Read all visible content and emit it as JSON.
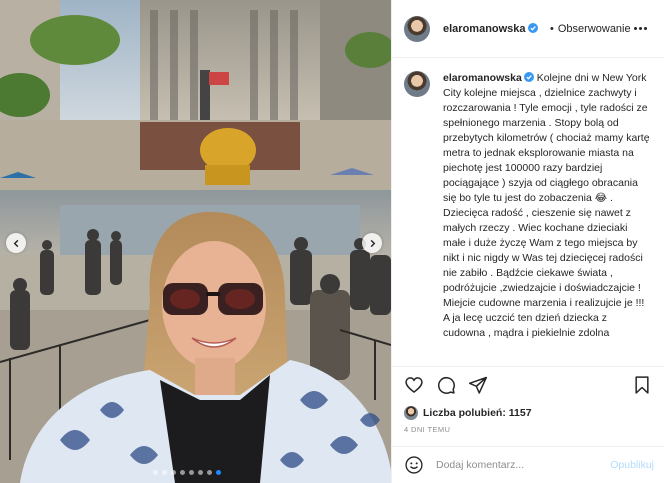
{
  "post": {
    "username": "elaromanowska",
    "follow_label": "Obserwowanie",
    "separator": "•",
    "caption": "Kolejne dni w New York City kolejne miejsca , dzielnice zachwyty i rozczarowania ! Tyle emocji , tyle radości ze spełnionego marzenia . Stopy bolą od przebytych kilometrów ( chociaż mamy kartę metra to jednak eksplorowanie miasta na piechotę jest 100000 razy bardziej pociągające ) szyja od ciągłego obracania się bo tyle tu jest do zobaczenia 😂 . Dziecięca radość , cieszenie się nawet z małych rzeczy . Wiec kochane dzieciaki małe i duże życzę Wam z tego miejsca by nikt i nic nigdy w Was tej dziecięcej radości nie zabiło . Bądźcie ciekawe świata , podróżujcie ,zwiedzajcie i doświadczajcie ! Miejcie cudowne marzenia i realizujcie je !!! A ja lecę uczcić ten dzień dziecka z cudowna , mądra i piekielnie zdolna",
    "likes_label": "Liczba polubień: 1157",
    "timestamp": "4 DNI TEMU",
    "comment_placeholder": "Dodaj komentarz...",
    "publish_label": "Opublikuj"
  },
  "carousel": {
    "slide_count": 8,
    "active_index": 7
  },
  "colors": {
    "accent": "#1a8cff",
    "verified": "#3897f0",
    "publish_disabled": "#b3dbff",
    "border": "#efefef"
  },
  "icons": [
    "verified-badge-icon",
    "more-options-icon",
    "heart-icon",
    "comment-icon",
    "share-icon",
    "bookmark-icon",
    "emoji-icon",
    "chevron-left-icon",
    "chevron-right-icon"
  ]
}
